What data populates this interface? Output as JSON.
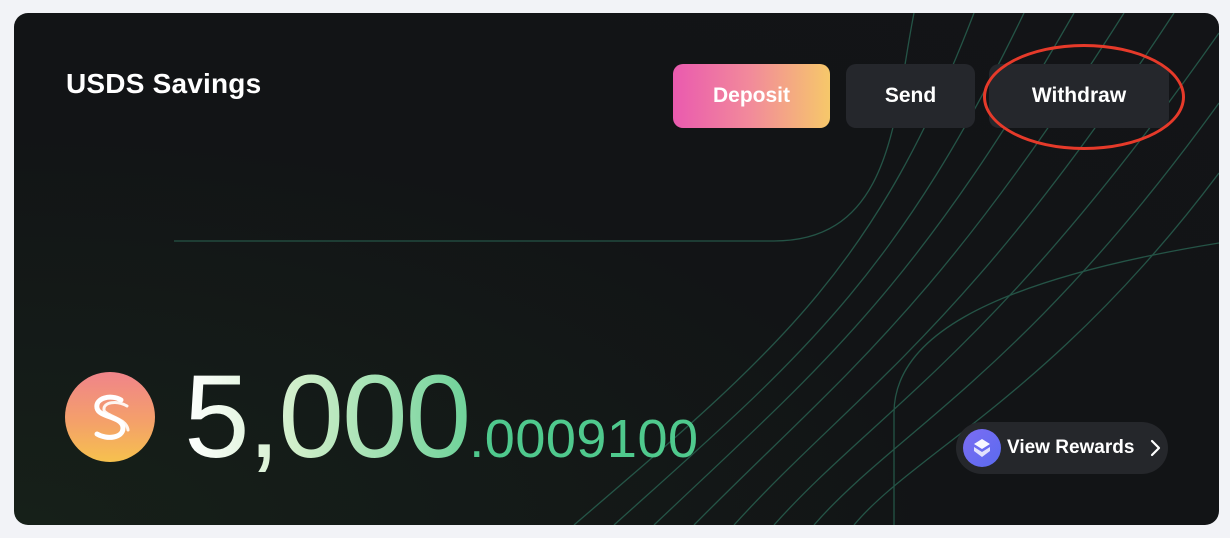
{
  "card": {
    "title": "USDS Savings"
  },
  "actions": {
    "deposit_label": "Deposit",
    "send_label": "Send",
    "withdraw_label": "Withdraw"
  },
  "balance": {
    "token_icon": "usds-token-icon",
    "integer": "5,000",
    "fraction": ".0009100"
  },
  "rewards": {
    "label": "View Rewards",
    "icon": "rewards-icon",
    "chevron": "chevron-right-icon"
  },
  "colors": {
    "card_background": "#131417",
    "deposit_gradient_start": "#ea5aaf",
    "deposit_gradient_end": "#f6c86a",
    "secondary_button": "#25272c",
    "balance_accent": "#4fc98d",
    "highlight_annotation": "#e63a2a"
  }
}
